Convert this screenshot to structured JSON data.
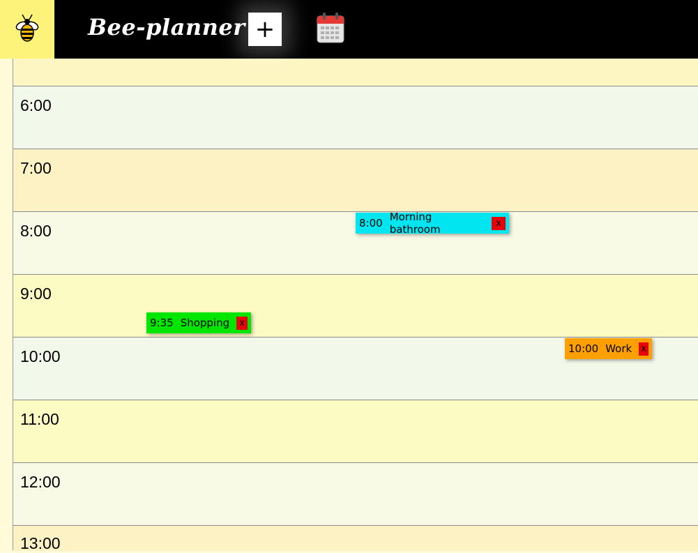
{
  "header": {
    "app_title": "Bee-planner",
    "add_label": "+",
    "logo_icon": "bee-icon",
    "calendar_icon": "calendar-icon"
  },
  "schedule": {
    "rows": [
      {
        "label": "",
        "color": "#fdf6c3"
      },
      {
        "label": "6:00",
        "color": "#f3f9ea"
      },
      {
        "label": "7:00",
        "color": "#fdf2c4"
      },
      {
        "label": "8:00",
        "color": "#f8fae6"
      },
      {
        "label": "9:00",
        "color": "#fdfbc4"
      },
      {
        "label": "10:00",
        "color": "#f3f9ea"
      },
      {
        "label": "11:00",
        "color": "#fdfbc4"
      },
      {
        "label": "12:00",
        "color": "#f8fae6"
      },
      {
        "label": "13:00",
        "color": "#fdf2c4"
      }
    ],
    "events": [
      {
        "time": "8:00",
        "title": "Morning bathroom",
        "delete_label": "x",
        "color": "#00e5f0"
      },
      {
        "time": "9:35",
        "title": "Shopping",
        "delete_label": "x",
        "color": "#00e600"
      },
      {
        "time": "10:00",
        "title": "Work",
        "delete_label": "x",
        "color": "#ffa000"
      }
    ]
  }
}
